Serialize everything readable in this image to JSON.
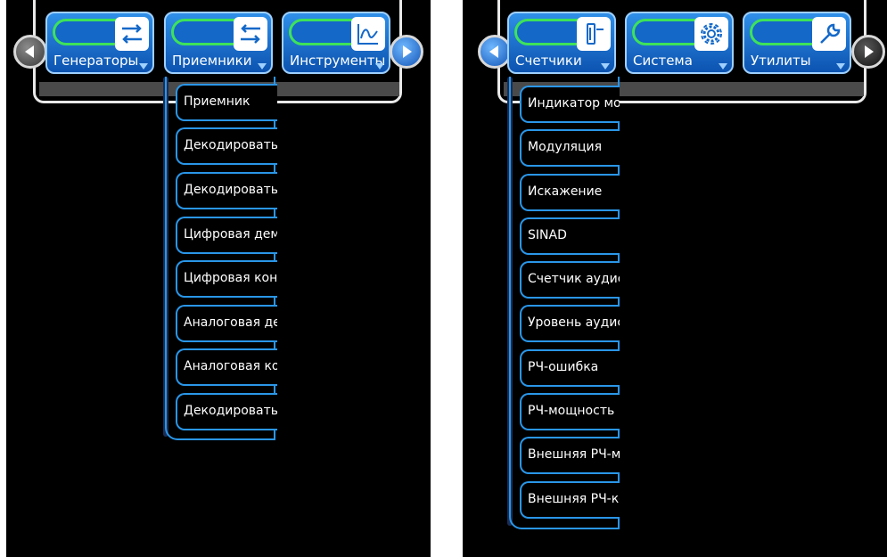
{
  "left_screen": {
    "tabs": [
      {
        "label": "Генераторы",
        "icon": "swap-arrows-icon"
      },
      {
        "label": "Приемники",
        "icon": "swap-arrows-icon"
      },
      {
        "label": "Инструменты",
        "icon": "waveform-icon"
      }
    ],
    "menu_items": [
      "Приемник",
      "Декодировать",
      "Декодировать",
      "Цифровая дем",
      "Цифровая кон",
      "Аналоговая де",
      "Аналоговая ко",
      "Декодировать"
    ]
  },
  "right_screen": {
    "tabs": [
      {
        "label": "Счетчики",
        "icon": "meter-icon"
      },
      {
        "label": "Система",
        "icon": "gear-icon"
      },
      {
        "label": "Утилиты",
        "icon": "wrench-icon"
      }
    ],
    "menu_items": [
      "Индикатор мо",
      "Модуляция",
      "Искажение",
      "SINAD",
      "Счетчик аудис",
      "Уровень аудис",
      "РЧ-ошибка",
      "РЧ-мощность",
      "Внешняя РЧ-м",
      "Внешняя РЧ-кс"
    ]
  },
  "colors": {
    "accent_blue": "#1468c8",
    "highlight_green": "#3ee25a",
    "menu_border": "#2a96e8"
  }
}
